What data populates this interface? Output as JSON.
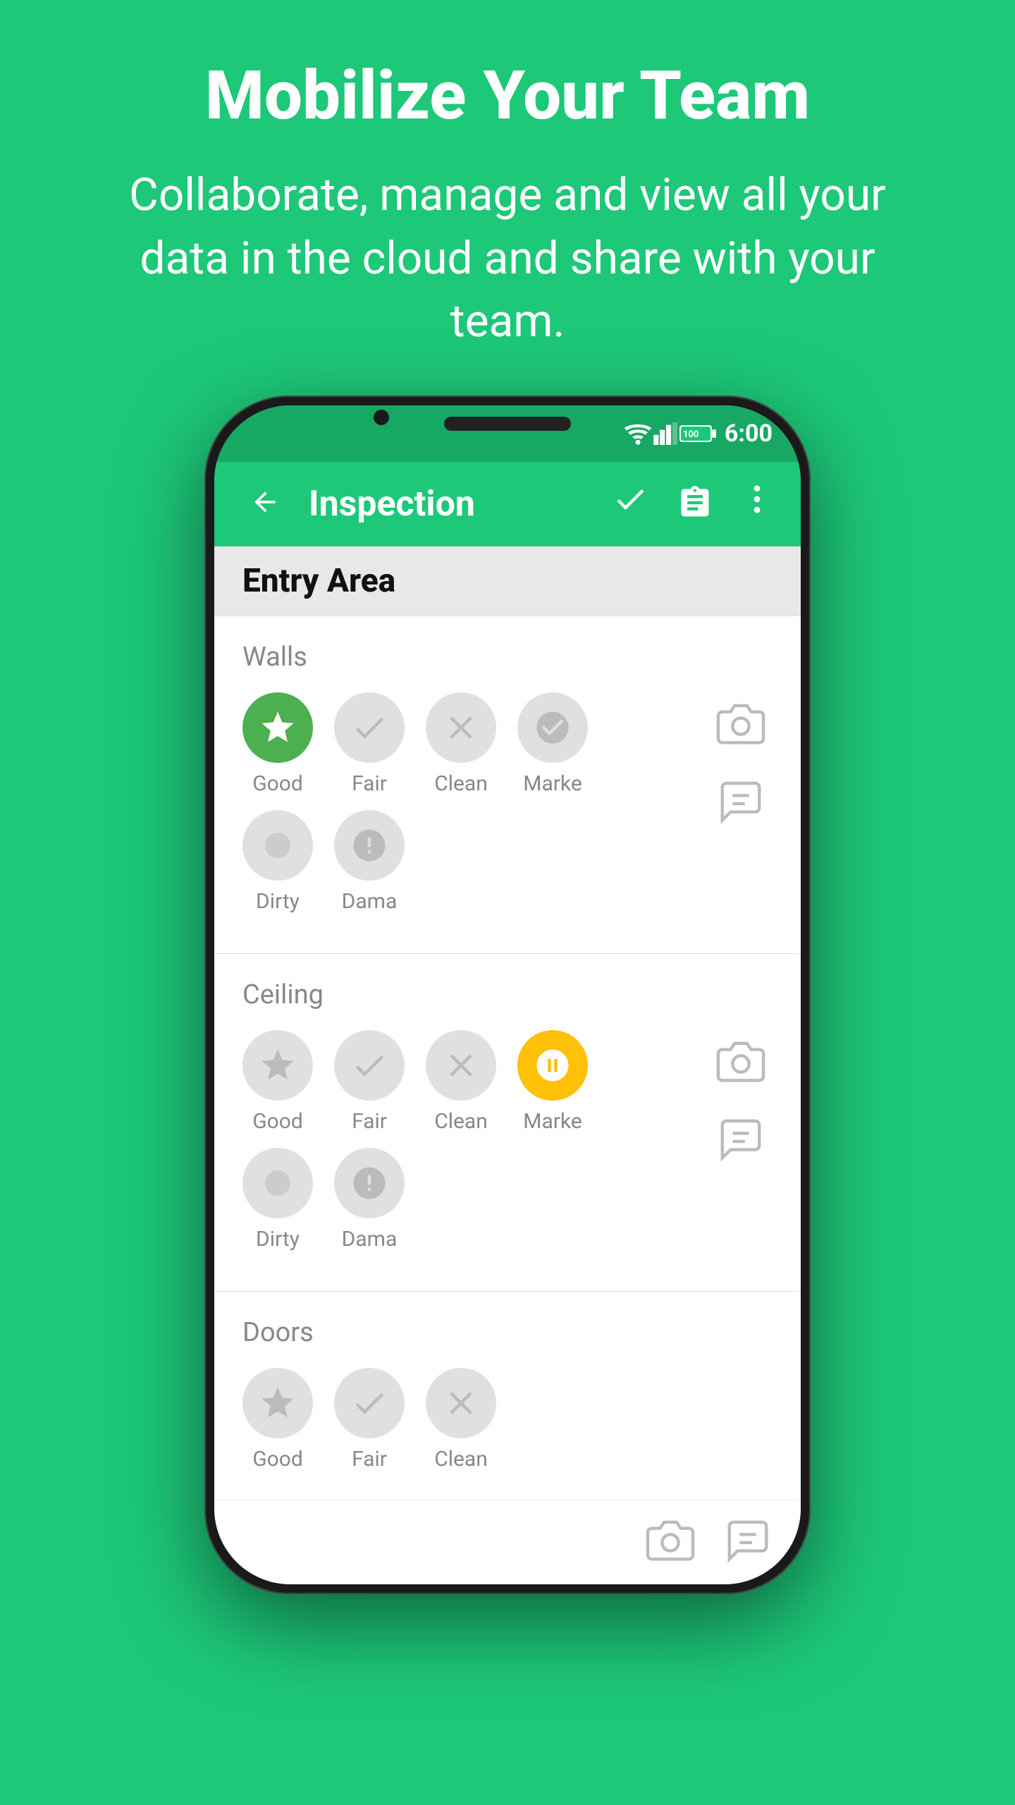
{
  "page": {
    "background_color": "#1DC879",
    "header": {
      "title": "Mobilize Your Team",
      "subtitle": "Collaborate, manage and view all your data in the cloud and share with your team."
    },
    "status_bar": {
      "time": "6:00",
      "battery": "100"
    },
    "toolbar": {
      "title": "Inspection",
      "back_label": "←",
      "check_icon": "✓",
      "clipboard_icon": "📋",
      "more_icon": "⋮"
    },
    "section": {
      "title": "Entry Area",
      "items": [
        {
          "id": "walls",
          "label": "Walls",
          "options": [
            {
              "id": "good",
              "label": "Good",
              "active": true,
              "color": "green"
            },
            {
              "id": "fair",
              "label": "Fair",
              "active": false,
              "color": "none"
            },
            {
              "id": "clean",
              "label": "Clean",
              "active": false,
              "color": "none"
            },
            {
              "id": "marked",
              "label": "Marke",
              "active": false,
              "color": "none"
            },
            {
              "id": "dirty",
              "label": "Dirty",
              "active": false,
              "color": "none"
            },
            {
              "id": "damaged",
              "label": "Dama",
              "active": false,
              "color": "none"
            }
          ]
        },
        {
          "id": "ceiling",
          "label": "Ceiling",
          "options": [
            {
              "id": "good",
              "label": "Good",
              "active": false,
              "color": "none"
            },
            {
              "id": "fair",
              "label": "Fair",
              "active": false,
              "color": "none"
            },
            {
              "id": "clean",
              "label": "Clean",
              "active": false,
              "color": "none"
            },
            {
              "id": "marked",
              "label": "Marke",
              "active": true,
              "color": "yellow"
            },
            {
              "id": "dirty",
              "label": "Dirty",
              "active": false,
              "color": "none"
            },
            {
              "id": "damaged",
              "label": "Dama",
              "active": false,
              "color": "none"
            }
          ]
        },
        {
          "id": "doors",
          "label": "Doors",
          "options": [
            {
              "id": "good",
              "label": "Good",
              "active": false,
              "color": "none"
            },
            {
              "id": "fair",
              "label": "Fair",
              "active": false,
              "color": "none"
            },
            {
              "id": "clean",
              "label": "Clean",
              "active": false,
              "color": "none"
            }
          ]
        }
      ]
    }
  }
}
